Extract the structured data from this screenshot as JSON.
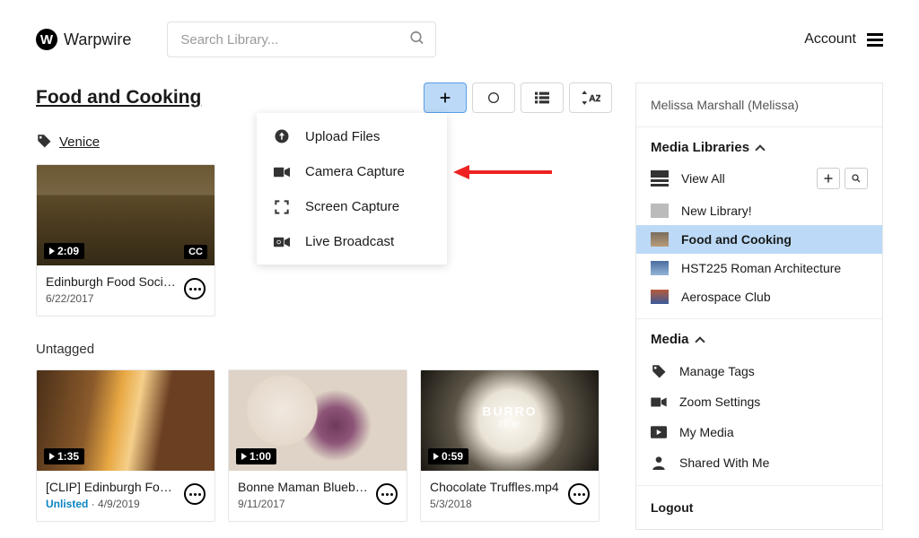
{
  "app": {
    "name": "Warpwire"
  },
  "search": {
    "placeholder": "Search Library..."
  },
  "account": {
    "label": "Account"
  },
  "page": {
    "title": "Food and Cooking"
  },
  "tag": {
    "name": "Venice"
  },
  "dropdown": {
    "items": [
      {
        "label": "Upload Files"
      },
      {
        "label": "Camera Capture"
      },
      {
        "label": "Screen Capture"
      },
      {
        "label": "Live Broadcast"
      }
    ]
  },
  "videos_tagged": [
    {
      "title": "Edinburgh Food Soci…",
      "date": "6/22/2017",
      "duration": "2:09",
      "cc": "CC"
    }
  ],
  "section_untagged": "Untagged",
  "videos_untagged": [
    {
      "title": "[CLIP] Edinburgh Fo…",
      "status": "Unlisted",
      "sep": " · ",
      "date": "4/9/2019",
      "duration": "1:35"
    },
    {
      "title": "Bonne Maman Blueb…",
      "date": "9/11/2017",
      "duration": "1:00"
    },
    {
      "title": "Chocolate Truffles.mp4",
      "date": "5/3/2018",
      "duration": "0:59",
      "overlay": "BURRO",
      "overlay_sub": "25 gr"
    }
  ],
  "sidebar": {
    "user": "Melissa Marshall (Melissa)",
    "media_libraries_head": "Media Libraries",
    "view_all": "View All",
    "libraries": [
      {
        "name": "New Library!"
      },
      {
        "name": "Food and Cooking"
      },
      {
        "name": "HST225 Roman Architecture"
      },
      {
        "name": "Aerospace Club"
      }
    ],
    "media_head": "Media",
    "media_items": [
      {
        "label": "Manage Tags"
      },
      {
        "label": "Zoom Settings"
      },
      {
        "label": "My Media"
      },
      {
        "label": "Shared With Me"
      }
    ],
    "logout": "Logout"
  }
}
